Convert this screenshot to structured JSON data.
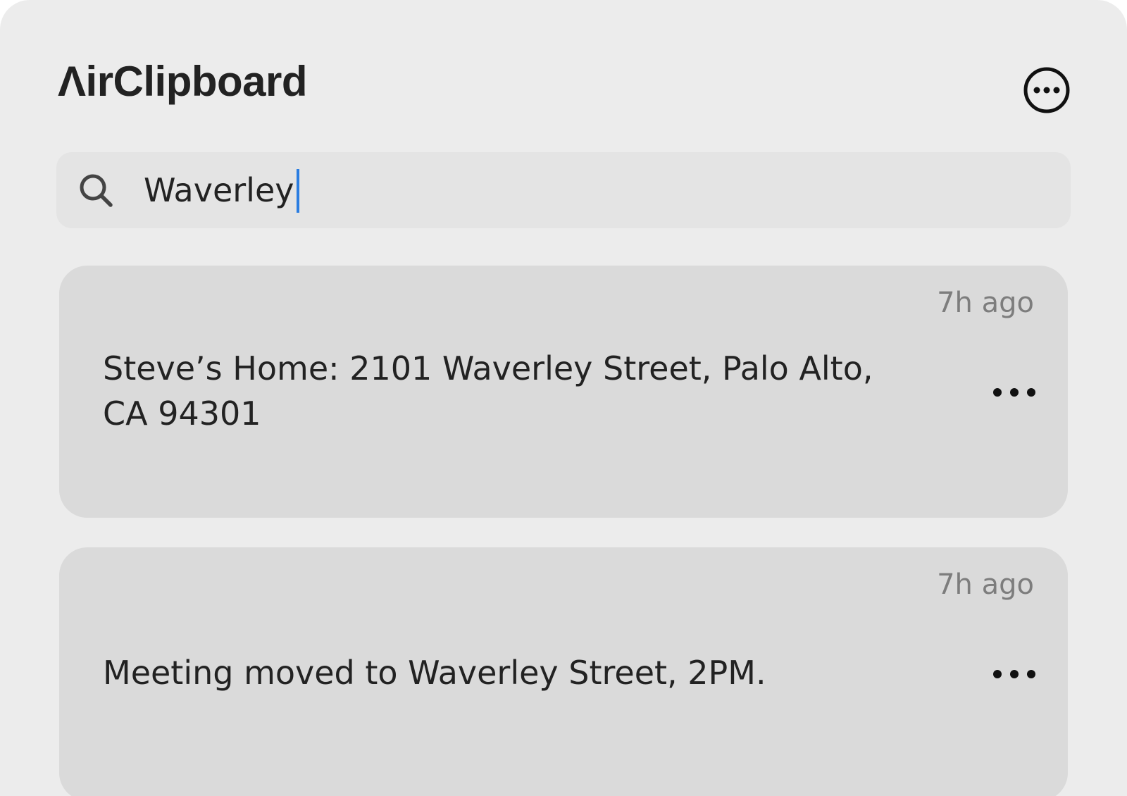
{
  "header": {
    "title": "ΛirClipboard",
    "more_icon": "ellipsis-circle-icon"
  },
  "search": {
    "icon": "search-icon",
    "value": "Waverley",
    "placeholder": ""
  },
  "clips": [
    {
      "time": "7h ago",
      "text": "Steve’s Home: 2101 Waverley Street, Palo Alto, CA 94301",
      "more_icon": "ellipsis-icon"
    },
    {
      "time": "7h ago",
      "text": "Meeting moved to Waverley Street, 2PM.",
      "more_icon": "ellipsis-icon"
    }
  ],
  "colors": {
    "window_bg": "#ececec",
    "card_bg": "#dadada",
    "search_bg": "#e4e4e4",
    "caret": "#2a7de1",
    "text": "#222222",
    "muted": "#7d7d7d"
  }
}
